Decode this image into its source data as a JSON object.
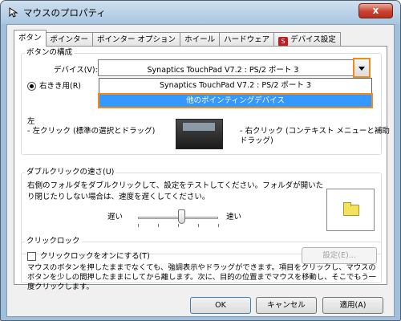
{
  "window": {
    "title": "マウスのプロパティ",
    "close_label": "x"
  },
  "tabs": [
    "ボタン",
    "ポインター",
    "ポインター オプション",
    "ホイール",
    "ハードウェア",
    "デバイス設定"
  ],
  "button_config": {
    "legend": "ボタンの構成",
    "device_label": "デバイス(V):",
    "device_value": "Synaptics TouchPad V7.2 : PS/2 ポート 3",
    "dropdown_options": [
      "Synaptics TouchPad V7.2 : PS/2 ポート 3",
      "他のポインティングデバイス"
    ],
    "right_handed_label": "右きき用(R)",
    "left_label": "左",
    "left_click_desc": "- 左クリック (標準の選択とドラッグ)",
    "right_click_desc": "- 右クリック (コンテキスト メニューと補助",
    "right_click_desc2": "ドラッグ)"
  },
  "double_click": {
    "legend": "ダブルクリックの速さ(U)",
    "description": "右側のフォルダをダブルクリックして、設定をテストしてください。フォルダが開いたり閉じたりしない場合は、速度を遅くしてください。",
    "slow_label": "遅い",
    "fast_label": "速い",
    "speed_level": 0.55
  },
  "click_lock": {
    "legend": "クリックロック",
    "checkbox_label": "クリックロックをオンにする(T)",
    "settings_button": "設定(E)...",
    "description": "マウスのボタンを押したままでなくても、強調表示やドラッグができます。項目をクリックし、マウスのボタンを少しの間押したままにしてから離します。次に、目的の位置までマウスを移動し、そこでもう一度クリックします。"
  },
  "buttons": {
    "ok": "OK",
    "cancel": "キャンセル",
    "apply": "適用(A)"
  },
  "colors": {
    "highlight": "#3399ff",
    "callout": "#f08a1c",
    "titlebar": "#a8c6e1"
  }
}
